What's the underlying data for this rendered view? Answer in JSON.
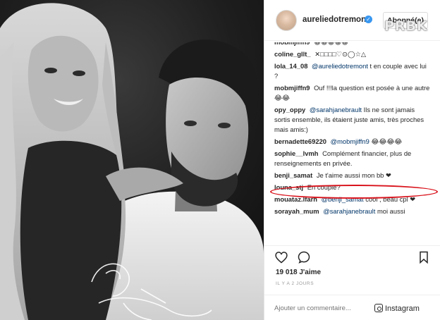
{
  "post": {
    "username": "aureliedotremont",
    "follow_label": "Abonné(e)",
    "watermark": "PRBK"
  },
  "comments": [
    {
      "user": "mobmjiffn9",
      "text": "😀😀😀😀😀"
    },
    {
      "user": "coline_gllt_",
      "text": "✕□□□□♡⊙◯☆△"
    },
    {
      "user": "lola_14_08",
      "mention": "@aureliedotremont",
      "text": " t en couple avec lui ?"
    },
    {
      "user": "mobmjiffn9",
      "text": "Ouf !!!la question est posée à une autre😂😂"
    },
    {
      "user": "opy_oppy",
      "mention": "@sarahjanebrault",
      "text": " Ils ne sont jamais sortis ensemble, ils étaient juste amis, très proches mais amis:)"
    },
    {
      "user": "bernadette69220",
      "mention": "@mobmjiffn9",
      "text": " 😂😂😂😂"
    },
    {
      "user": "sophie__lvmh",
      "text": "Complément financier, plus de renseignements en privée."
    },
    {
      "user": "benji_samat",
      "text": "Je t'aime aussi mon bb ❤"
    },
    {
      "user": "louna_stj",
      "text": "En couple?"
    },
    {
      "user": "mouataz.lfarh",
      "mention": "@benji_samat",
      "text": " cool , beau cpl ❤"
    },
    {
      "user": "sorayah_mum",
      "mention": "@sarahjanebrault",
      "text": " moi aussi"
    }
  ],
  "actions": {
    "likes": "19 018 J'aime",
    "time": "IL Y A 2 JOURS",
    "add_comment_placeholder": "Ajouter un commentaire...",
    "credit": "Instagram"
  },
  "icons": {
    "heart": "heart-icon",
    "comment": "comment-icon",
    "bookmark": "bookmark-icon",
    "verified": "verified-badge-icon"
  },
  "colors": {
    "highlight": "#d9141d",
    "verified": "#3897f0",
    "mention": "#003569"
  }
}
